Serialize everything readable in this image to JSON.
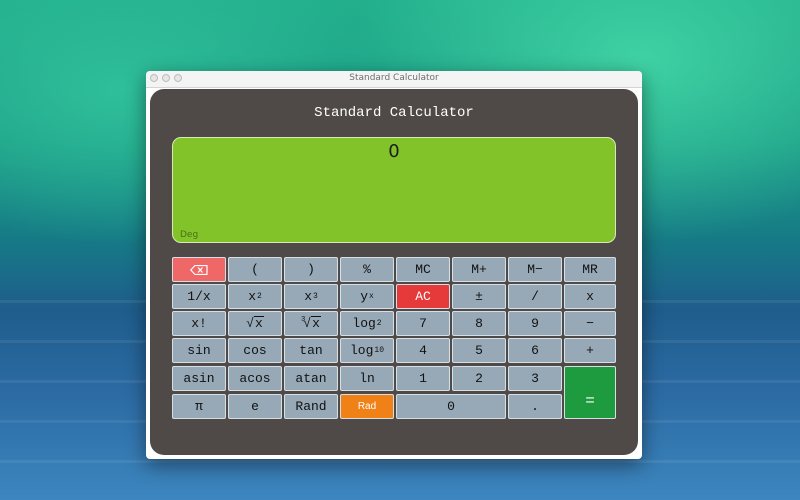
{
  "window": {
    "title": "Standard Calculator"
  },
  "calculator": {
    "title": "Standard Calculator",
    "display": {
      "value": "0",
      "mode": "Deg"
    }
  },
  "keys": {
    "backspace": {
      "icon": "backspace-icon"
    },
    "open_paren": "(",
    "close_paren": ")",
    "percent": "%",
    "mc": "MC",
    "m_plus": "M+",
    "m_minus": "M−",
    "mr": "MR",
    "reciprocal": "1/x",
    "square_base": "x",
    "square_exp": "2",
    "cube_base": "x",
    "cube_exp": "3",
    "power_base": "y",
    "power_exp": "x",
    "ac": "AC",
    "plus_minus": "±",
    "divide": "/",
    "multiply": "x",
    "factorial": "x!",
    "sqrt_x": "x",
    "cbrt_idx": "3",
    "cbrt_x": "x",
    "log2_base": "log",
    "log2_sub": "2",
    "seven": "7",
    "eight": "8",
    "nine": "9",
    "minus": "−",
    "sin": "sin",
    "cos": "cos",
    "tan": "tan",
    "log10_base": "log",
    "log10_sub": "10",
    "four": "4",
    "five": "5",
    "six": "6",
    "plus": "+",
    "asin": "asin",
    "acos": "acos",
    "atan": "atan",
    "ln": "ln",
    "one": "1",
    "two": "2",
    "three": "3",
    "equals": "=",
    "pi": "π",
    "e": "e",
    "rand": "Rand",
    "rad": "Rad",
    "zero": "0",
    "dot": "."
  },
  "colors": {
    "panel": "#4f4a48",
    "display": "#82c32a",
    "key": "#97a9b7",
    "ac": "#e63a3a",
    "backspace": "#f06767",
    "rad": "#f08116",
    "equals": "#1e9a3f"
  }
}
